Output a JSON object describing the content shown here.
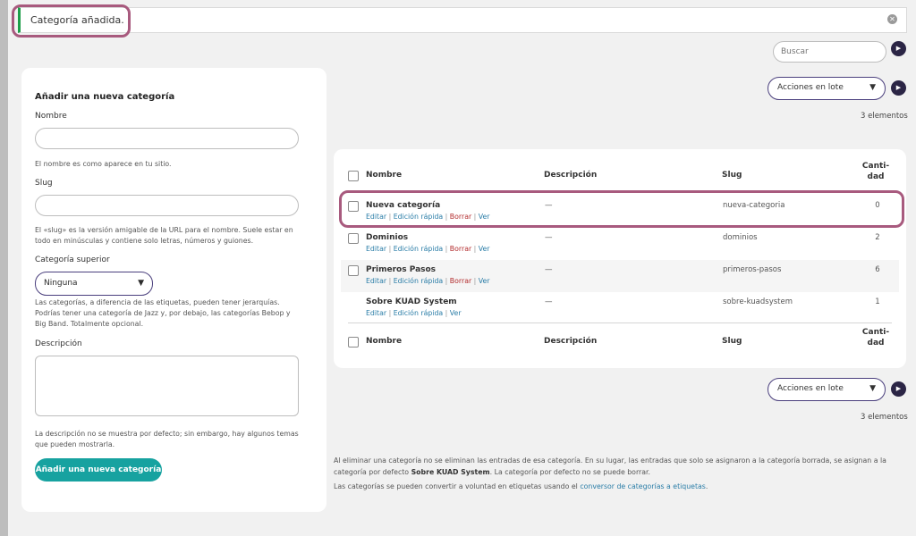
{
  "notice": {
    "text": "Categoría añadida."
  },
  "search": {
    "placeholder": "Buscar"
  },
  "bulk_actions": {
    "label": "Acciones en lote"
  },
  "item_count": "3 elementos",
  "form": {
    "heading": "Añadir una nueva categoría",
    "name_label": "Nombre",
    "name_hint": "El nombre es como aparece en tu sitio.",
    "slug_label": "Slug",
    "slug_hint": "El «slug» es la versión amigable de la URL para el nombre. Suele estar en todo en minúsculas y contiene solo letras, números y guiones.",
    "parent_label": "Categoría superior",
    "parent_value": "Ninguna",
    "parent_hint": "Las categorías, a diferencia de las etiquetas, pueden tener jerarquías. Podrías tener una categoría de Jazz y, por debajo, las categorías Bebop y Big Band. Totalmente opcional.",
    "description_label": "Descripción",
    "description_hint": "La descripción no se muestra por defecto; sin embargo, hay algunos temas que pueden mostrarla.",
    "submit_label": "Añadir una nueva categoría"
  },
  "table": {
    "columns": {
      "name": "Nombre",
      "description": "Descripción",
      "slug": "Slug",
      "count": "Cantidad"
    },
    "count_header_line1": "Canti-",
    "count_header_line2": "dad",
    "rows": [
      {
        "name": "Nueva categoría",
        "description": "—",
        "slug": "nueva-categoria",
        "count": "0",
        "actions": [
          "Editar",
          "Edición rápida",
          "Borrar",
          "Ver"
        ]
      },
      {
        "name": "Dominios",
        "description": "—",
        "slug": "dominios",
        "count": "2",
        "actions": [
          "Editar",
          "Edición rápida",
          "Borrar",
          "Ver"
        ]
      },
      {
        "name": "Primeros Pasos",
        "description": "—",
        "slug": "primeros-pasos",
        "count": "6",
        "actions": [
          "Editar",
          "Edición rápida",
          "Borrar",
          "Ver"
        ]
      },
      {
        "name": "Sobre KUAD System",
        "description": "—",
        "slug": "sobre-kuadsystem",
        "count": "1",
        "actions": [
          "Editar",
          "Edición rápida",
          "Ver"
        ]
      }
    ]
  },
  "footer_note": {
    "line1_a": "Al eliminar una categoría no se eliminan las entradas de esa categoría. En su lugar, las entradas que solo se asignaron a la categoría borrada, se asignan a la categoría por defecto ",
    "line1_bold": "Sobre KUAD System",
    "line1_b": ". La categoría por defecto no se puede borrar.",
    "line2_a": "Las categorías se pueden convertir a voluntad en etiquetas usando el ",
    "line2_link": "conversor de categorías a etiquetas",
    "line2_b": "."
  },
  "colors": {
    "accent": "#17a2a0",
    "highlight": "#a85a7e",
    "success": "#1e9e4a",
    "select_border": "#4a3f7d"
  }
}
